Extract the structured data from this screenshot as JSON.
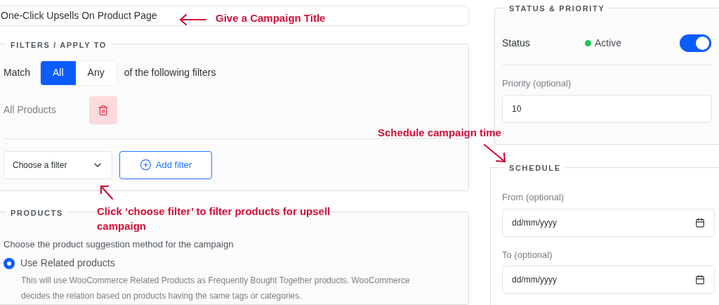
{
  "campaign_title": {
    "value": "One-Click Upsells On Product Page"
  },
  "filters": {
    "legend": "FILTERS / APPLY TO",
    "match_label": "Match",
    "match_options": [
      {
        "label": "All",
        "selected": true
      },
      {
        "label": "Any",
        "selected": false
      }
    ],
    "match_suffix": "of the following filters",
    "rules": [
      {
        "label": "All Products"
      }
    ],
    "filter_select": {
      "value": "Choose a filter"
    },
    "add_button": "Add filter"
  },
  "products": {
    "legend": "PRODUCTS",
    "prompt": "Choose the product suggestion method for the campaign",
    "options": [
      {
        "label": "Use Related products",
        "selected": true,
        "description": "This will use WooCommerce Related Products as Frequently Bought Together products. WooCommerce decides the relation based on products having the same tags or categories."
      }
    ]
  },
  "status_priority": {
    "legend": "STATUS & PRIORITY",
    "status_label": "Status",
    "status_text": "Active",
    "active": true,
    "priority_label": "Priority (optional)",
    "priority_value": "10"
  },
  "schedule": {
    "legend": "SCHEDULE",
    "fields": [
      {
        "label": "From (optional)",
        "placeholder": "dd/mm/yyyy"
      },
      {
        "label": "To (optional)",
        "placeholder": "dd/mm/yyyy"
      }
    ]
  },
  "annotations": [
    {
      "text": "Give a Campaign Title"
    },
    {
      "text": "Schedule campaign time"
    },
    {
      "text": "Click ‘choose filter’ to filter products for upsell campaign"
    }
  ]
}
